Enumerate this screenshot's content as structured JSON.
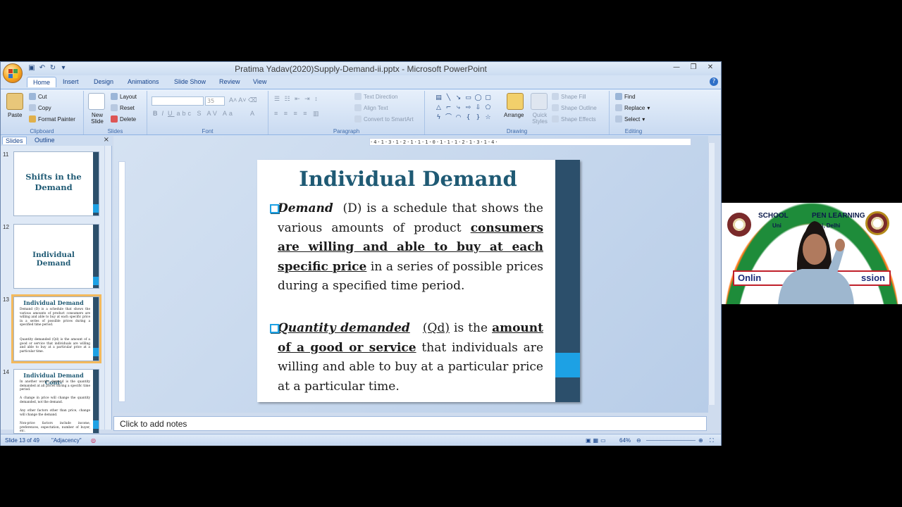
{
  "window": {
    "title": "Pratima Yadav(2020)Supply-Demand-ii.pptx - Microsoft PowerPoint"
  },
  "tabs": [
    "Home",
    "Insert",
    "Design",
    "Animations",
    "Slide Show",
    "Review",
    "View"
  ],
  "ribbon": {
    "clipboard": {
      "paste": "Paste",
      "cut": "Cut",
      "copy": "Copy",
      "format_painter": "Format Painter",
      "label": "Clipboard"
    },
    "slides": {
      "new_slide": "New Slide",
      "layout": "Layout",
      "reset": "Reset",
      "delete": "Delete",
      "label": "Slides"
    },
    "font": {
      "size": "35",
      "label": "Font"
    },
    "paragraph": {
      "text_direction": "Text Direction",
      "align_text": "Align Text",
      "convert_smartart": "Convert to SmartArt",
      "label": "Paragraph"
    },
    "drawing": {
      "arrange": "Arrange",
      "quick_styles": "Quick Styles",
      "shape_fill": "Shape Fill",
      "shape_outline": "Shape Outline",
      "shape_effects": "Shape Effects",
      "label": "Drawing"
    },
    "editing": {
      "find": "Find",
      "replace": "Replace",
      "select": "Select",
      "label": "Editing"
    }
  },
  "pane": {
    "tabs": [
      "Slides",
      "Outline"
    ],
    "thumbs": [
      {
        "num": "11",
        "title": "Shifts in the Demand"
      },
      {
        "num": "12",
        "title": "Individual Demand"
      },
      {
        "num": "13",
        "title": "Individual Demand",
        "lines": [
          "Demand (D) is a schedule that shows the various amounts of product consumers are willing and able to buy at each specific price in a series of possible prices during a specified time period.",
          "Quantity demanded (Qd) is the amount of a good or service that individuals are willing and able to buy at a particular price at a particular time."
        ]
      },
      {
        "num": "14",
        "title": "Individual Demand Cont-",
        "lines": [
          "In another words, demand is the quantity demanded at all prices during a specific time period.",
          "A change in price will change the quantity demanded, not the demand.",
          "Any other factors other than price, change will change the demand.",
          "Non-price factors include income, preferences, expectation, number of buyer, etc."
        ]
      }
    ]
  },
  "slide": {
    "title": "Individual Demand",
    "b1_term": "Demand",
    "b1_abbr": "(D)",
    "b1_text1": "is a schedule that shows the various amounts of product",
    "b1_ul": "consumers are willing and able to buy at each specific price",
    "b1_text2": "in a series of possible prices during a specified time period.",
    "b2_term": "Quantity demanded",
    "b2_abbr": "(Qd)",
    "b2_text1": "is the",
    "b2_ul": "amount of a good or service",
    "b2_text2": "that individuals are willing and able to buy at a particular price at a particular time."
  },
  "ruler": "·4·1·3·1·2·1·1·1·0·1·1·1·2·1·3·1·4·",
  "notes": {
    "placeholder": "Click to add notes"
  },
  "status": {
    "slide": "Slide 13 of 49",
    "theme": "\"Adjacency\"",
    "zoom": "64%"
  },
  "video": {
    "school": "SCHOOL OF OPEN LEARNING",
    "univ": "University of Delhi, Delhi",
    "univ_left": "Uni",
    "univ_right": "lhi, Delhi",
    "school_left": "SCHOOL",
    "school_right": "PEN LEARNING",
    "banner_left": "Onlin",
    "banner_right": "ssion"
  },
  "colors": {
    "title": "#1f5a74",
    "accent": "#1da1e4",
    "sidebar": "#2c4f6b",
    "ribbon": "#d5e3f5"
  }
}
